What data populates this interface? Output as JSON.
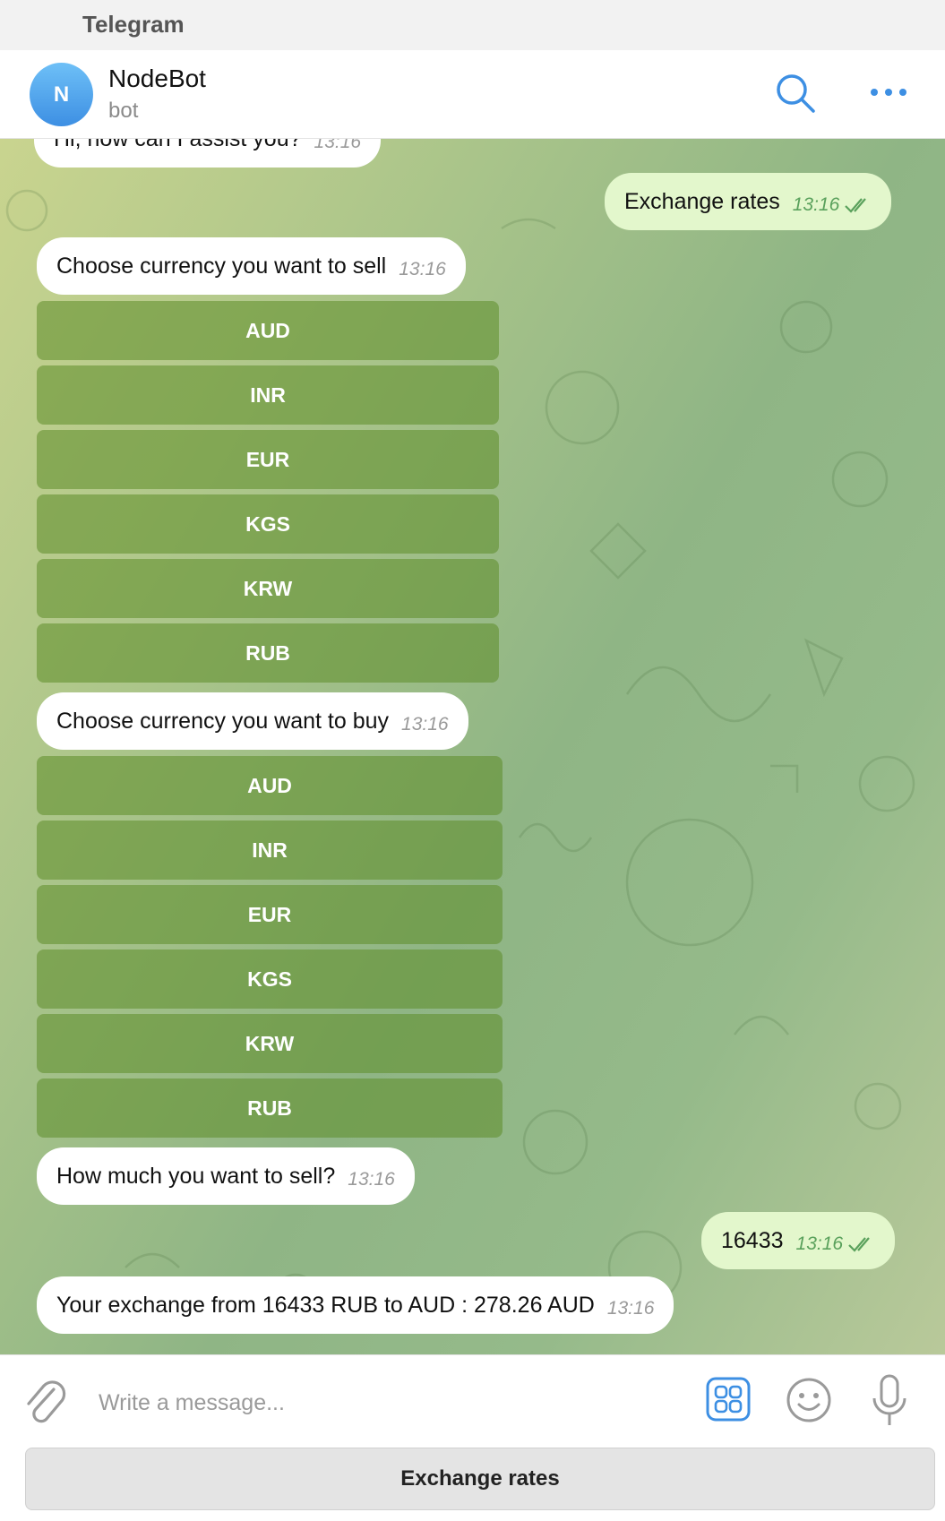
{
  "window": {
    "title": "Telegram"
  },
  "header": {
    "avatar_letter": "N",
    "name": "NodeBot",
    "subtitle": "bot"
  },
  "messages": [
    {
      "text": "Hi, how can I assist you?",
      "time": "13:16",
      "direction": "in"
    },
    {
      "text": "Exchange rates",
      "time": "13:16",
      "direction": "out"
    },
    {
      "text": "Choose currency you want to sell",
      "time": "13:16",
      "direction": "in"
    },
    {
      "text": "Choose currency you want to buy",
      "time": "13:16",
      "direction": "in"
    },
    {
      "text": "How much you want to sell?",
      "time": "13:16",
      "direction": "in"
    },
    {
      "text": "16433",
      "time": "13:16",
      "direction": "out"
    },
    {
      "text": "Your exchange from 16433 RUB to AUD : 278.26 AUD",
      "time": "13:16",
      "direction": "in"
    }
  ],
  "sell_buttons": [
    "AUD",
    "INR",
    "EUR",
    "KGS",
    "KRW",
    "RUB"
  ],
  "buy_buttons": [
    "AUD",
    "INR",
    "EUR",
    "KGS",
    "KRW",
    "RUB"
  ],
  "composer": {
    "placeholder": "Write a message..."
  },
  "reply_keyboard": {
    "button": "Exchange rates"
  },
  "colors": {
    "accent": "#3d8fe3",
    "outgoing_bubble": "#e3f7cc",
    "inline_button": "#6d9a3a"
  }
}
